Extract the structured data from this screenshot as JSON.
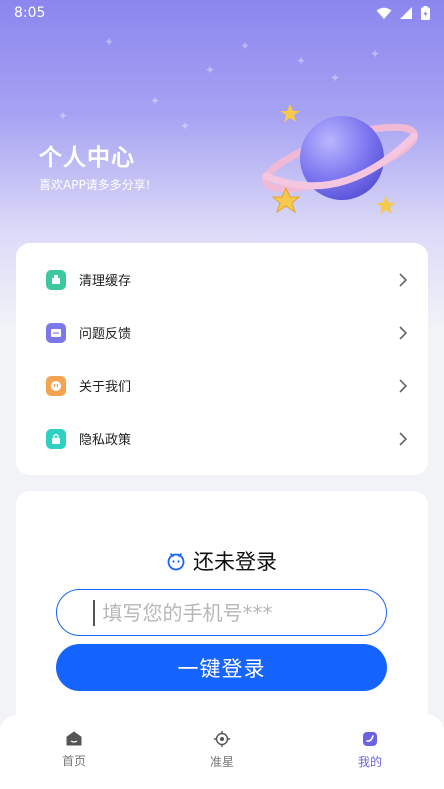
{
  "status_bar": {
    "time": "8:05",
    "icons": [
      "wifi-icon",
      "signal-icon",
      "battery-icon"
    ]
  },
  "header": {
    "title": "个人中心",
    "subtitle": "喜欢APP请多多分享!"
  },
  "menu": {
    "items": [
      {
        "label": "清理缓存",
        "icon": "clean-icon",
        "color": "#3cc9a0"
      },
      {
        "label": "问题反馈",
        "icon": "feedback-icon",
        "color": "#7d78ea"
      },
      {
        "label": "关于我们",
        "icon": "about-icon",
        "color": "#f4a451"
      },
      {
        "label": "隐私政策",
        "icon": "privacy-icon",
        "color": "#2fd0c1"
      }
    ]
  },
  "login": {
    "title": "还未登录",
    "phone_placeholder": "填写您的手机号***",
    "button_label": "一键登录"
  },
  "bottom_nav": {
    "items": [
      {
        "label": "首页",
        "icon": "home-icon",
        "active": false
      },
      {
        "label": "准星",
        "icon": "crosshair-icon",
        "active": false
      },
      {
        "label": "我的",
        "icon": "profile-icon",
        "active": true
      }
    ]
  },
  "colors": {
    "accent": "#1664ff",
    "nav_active": "#6b63e6",
    "hero_top": "#8b86ee"
  }
}
